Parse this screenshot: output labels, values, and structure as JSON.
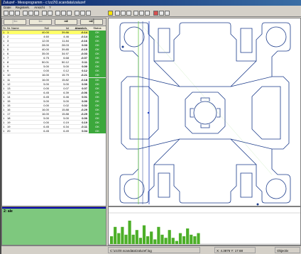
{
  "window": {
    "title": "Zaluzef - Messprogramm - c:\\zz2\\0.scandata\\zaluzef",
    "menus": [
      "Datei",
      "Registerk.",
      "Ansicht",
      "?"
    ]
  },
  "nav": {
    "buttons": [
      "|⇐",
      "⇐",
      "⇒",
      "⇒|"
    ]
  },
  "table": {
    "headers": {
      "sr": "Sr.",
      "nr": "Nr.",
      "name": "Name",
      "soll": "Soll",
      "ist": "Ist",
      "abw": "Abweich.",
      "status": "Status"
    },
    "rows": [
      {
        "sr": "1",
        "nr": "1",
        "name": "",
        "soll": "40.00",
        "ist": "39.86",
        "abw": "-0.14",
        "status": "OK",
        "selected": true
      },
      {
        "sr": "1",
        "nr": "2",
        "name": "",
        "soll": "4.60",
        "ist": "4.46",
        "abw": "-0.14",
        "status": "OK"
      },
      {
        "sr": "1",
        "nr": "3",
        "name": "",
        "soll": "12.00",
        "ist": "11.84",
        "abw": "-0.16",
        "status": "OK"
      },
      {
        "sr": "1",
        "nr": "4",
        "name": "",
        "soll": "28.00",
        "ist": "28.03",
        "abw": "0.03",
        "status": "OK"
      },
      {
        "sr": "1",
        "nr": "5",
        "name": "",
        "soll": "40.00",
        "ist": "39.85",
        "abw": "-0.15",
        "status": "OK"
      },
      {
        "sr": "1",
        "nr": "6",
        "name": "",
        "soll": "35.00",
        "ist": "34.97",
        "abw": "-0.03",
        "status": "OK"
      },
      {
        "sr": "1",
        "nr": "7",
        "name": "",
        "soll": "6.75",
        "ist": "6.68",
        "abw": "-0.07",
        "status": "OK"
      },
      {
        "sr": "1",
        "nr": "8",
        "name": "",
        "soll": "50.01",
        "ist": "50.12",
        "abw": "0.11",
        "status": "OK"
      },
      {
        "sr": "1",
        "nr": "9",
        "name": "",
        "soll": "5.00",
        "ist": "5.00",
        "abw": "0.00",
        "status": "OK"
      },
      {
        "sr": "1",
        "nr": "9",
        "name": "",
        "soll": "0.00",
        "ist": "0.12",
        "abw": "0.12",
        "status": "OK"
      },
      {
        "sr": "1",
        "nr": "10",
        "name": "",
        "soll": "16.00",
        "ist": "15.79",
        "abw": "-0.21",
        "status": "OK"
      },
      {
        "sr": "1",
        "nr": "11",
        "name": "",
        "soll": "16.00",
        "ist": "15.82",
        "abw": "-0.18",
        "status": "OK"
      },
      {
        "sr": "1",
        "nr": "12",
        "name": "",
        "soll": "5.00",
        "ist": "5.00",
        "abw": "0.00",
        "status": "OK"
      },
      {
        "sr": "1",
        "nr": "13",
        "name": "",
        "soll": "0.00",
        "ist": "0.07",
        "abw": "0.07",
        "status": "OK"
      },
      {
        "sr": "1",
        "nr": "13",
        "name": "",
        "soll": "6.45",
        "ist": "6.39",
        "abw": "-0.06",
        "status": "OK"
      },
      {
        "sr": "1",
        "nr": "14",
        "name": "",
        "soll": "6.45",
        "ist": "6.46",
        "abw": "0.01",
        "status": "OK"
      },
      {
        "sr": "1",
        "nr": "15",
        "name": "",
        "soll": "5.00",
        "ist": "5.00",
        "abw": "0.00",
        "status": "OK"
      },
      {
        "sr": "1",
        "nr": "15",
        "name": "",
        "soll": "0.00",
        "ist": "0.02",
        "abw": "0.02",
        "status": "OK"
      },
      {
        "sr": "1",
        "nr": "16",
        "name": "",
        "soll": "16.00",
        "ist": "15.88",
        "abw": "-0.29",
        "status": "OK"
      },
      {
        "sr": "1",
        "nr": "17",
        "name": "",
        "soll": "16.00",
        "ist": "15.88",
        "abw": "-0.29",
        "status": "OK"
      },
      {
        "sr": "1",
        "nr": "18",
        "name": "",
        "soll": "5.00",
        "ist": "5.00",
        "abw": "0.00",
        "status": "OK"
      },
      {
        "sr": "1",
        "nr": "19",
        "name": "",
        "soll": "0.00",
        "ist": "0.19",
        "abw": "0.19",
        "status": "OK"
      },
      {
        "sr": "1",
        "nr": "19",
        "name": "",
        "soll": "6.45",
        "ist": "6.34",
        "abw": "-0.11",
        "status": "OK"
      },
      {
        "sr": "1",
        "nr": "20",
        "name": "",
        "soll": "6.45",
        "ist": "6.49",
        "abw": "0.04",
        "status": "OK"
      }
    ]
  },
  "bottom_left": {
    "label": "2: ale"
  },
  "chart": {
    "bar_color": "#4caf28",
    "values": [
      0.25,
      0.55,
      0.35,
      0.55,
      0.3,
      0.75,
      0.3,
      0.45,
      0.2,
      0.6,
      0.25,
      0.4,
      0.15,
      0.55,
      0.3,
      0.2,
      0.45,
      0.2,
      0.1,
      0.35,
      0.25,
      0.5,
      0.3,
      0.25,
      0.35
    ]
  },
  "status": {
    "file": "C:\\zz2\\0.scandata\\zaluzef.log",
    "info": "X: 4.3876  Y: 17.68",
    "mode": "Objectiv"
  },
  "colors": {
    "ok_green": "#3ca83c",
    "selected_row": "#ffff66",
    "drawing_line": "#1a3a8a",
    "measure_line_green": "#6bc84b"
  }
}
